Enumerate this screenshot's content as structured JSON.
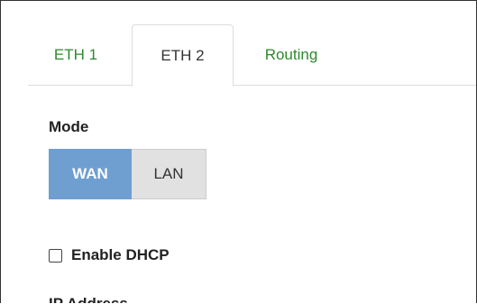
{
  "tabs": {
    "items": [
      {
        "label": "ETH 1",
        "active": false
      },
      {
        "label": "ETH 2",
        "active": true
      },
      {
        "label": "Routing",
        "active": false
      }
    ],
    "inactive_color": "#2d8a2d"
  },
  "mode": {
    "label": "Mode",
    "options": [
      "WAN",
      "LAN"
    ],
    "selected": "WAN",
    "selected_color": "#6f9fd0",
    "unselected_color": "#e1e1e1"
  },
  "dhcp": {
    "label": "Enable DHCP",
    "checked": false
  },
  "ip_address": {
    "label": "IP Address"
  }
}
